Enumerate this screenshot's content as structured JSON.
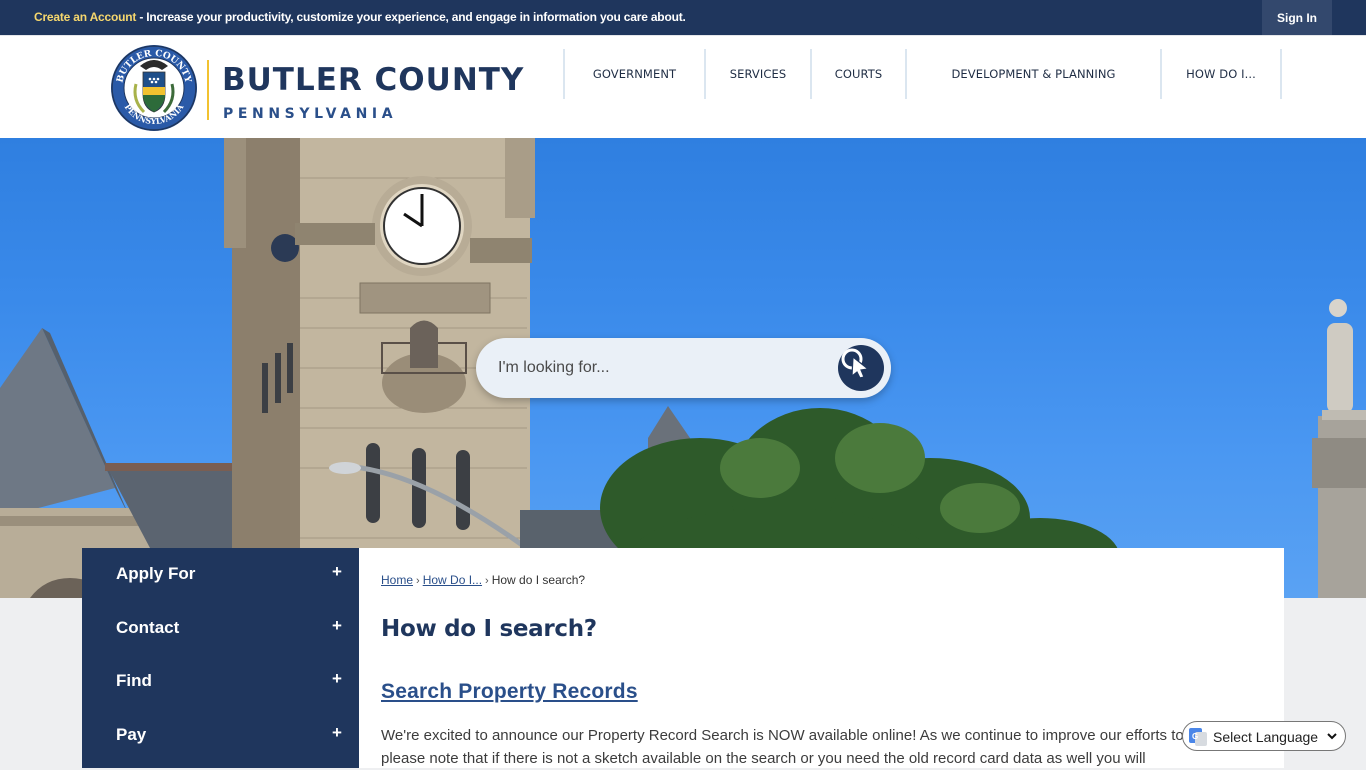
{
  "topbar": {
    "create_account_link": "Create an Account",
    "promo_text": " - Increase your productivity, customize your experience, and engage in information you care about.",
    "sign_in_label": "Sign In"
  },
  "header": {
    "logo_title": "BUTLER COUNTY",
    "logo_subtitle": "PENNSYLVANIA",
    "seal_top_text": "BUTLER COUNTY",
    "seal_bottom_text": "PENNSYLVANIA",
    "nav": [
      {
        "label": "GOVERNMENT"
      },
      {
        "label": "SERVICES"
      },
      {
        "label": "COURTS"
      },
      {
        "label": "DEVELOPMENT & PLANNING"
      },
      {
        "label": "HOW DO I..."
      }
    ]
  },
  "hero": {
    "search_placeholder": "I'm looking for...",
    "search_icon": "search-pointer-icon"
  },
  "sidebar": {
    "items": [
      {
        "label": "Apply For",
        "icon": "plus"
      },
      {
        "label": "Contact",
        "icon": "plus"
      },
      {
        "label": "Find",
        "icon": "plus"
      },
      {
        "label": "Pay",
        "icon": "plus"
      }
    ]
  },
  "content": {
    "breadcrumb": [
      {
        "label": "Home"
      },
      {
        "label": "How Do I..."
      },
      {
        "label": "How do I search?"
      }
    ],
    "breadcrumb_separator": "›",
    "page_title": "How do I search?",
    "section_link": "Search Property Records",
    "body_text": "We're excited to announce our Property Record Search is NOW available online! As we continue to improve our efforts to serve you, please note that if there is not a sketch available on the search or you need the old record card data as well you will"
  },
  "translate": {
    "label": "Select Language"
  },
  "colors": {
    "brand_navy": "#1f365d",
    "accent_gold": "#f2c230",
    "link_blue": "#2a4f8a",
    "page_background": "#eeeff1"
  }
}
